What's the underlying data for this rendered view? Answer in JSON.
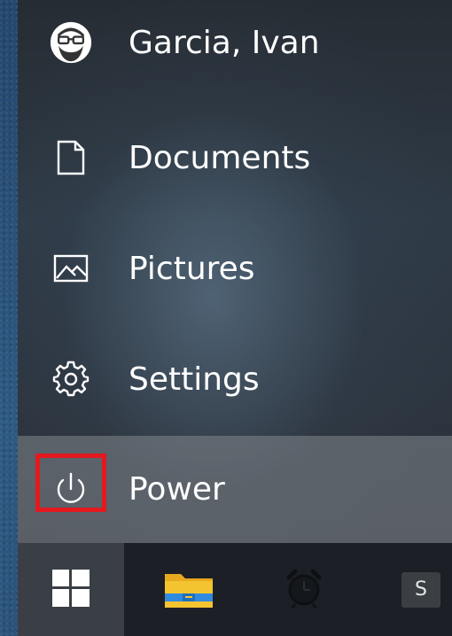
{
  "start_menu": {
    "user": {
      "name": "Garcia, Ivan",
      "icon": "avatar-icon"
    },
    "items": [
      {
        "label": "Documents",
        "icon": "document-icon"
      },
      {
        "label": "Pictures",
        "icon": "pictures-icon"
      },
      {
        "label": "Settings",
        "icon": "gear-icon"
      },
      {
        "label": "Power",
        "icon": "power-icon",
        "highlighted": true
      }
    ]
  },
  "taskbar": {
    "start": {
      "icon": "windows-logo-icon"
    },
    "apps": [
      {
        "icon": "file-explorer-icon"
      },
      {
        "icon": "alarm-clock-icon"
      },
      {
        "label": "S",
        "icon": "s-app-icon"
      }
    ]
  },
  "colors": {
    "highlight_border": "#e3191f",
    "power_row_bg": "#82878c",
    "taskbar_bg": "#1c2026",
    "explorer_yellow": "#f4c430",
    "explorer_blue": "#2f8ae0"
  }
}
